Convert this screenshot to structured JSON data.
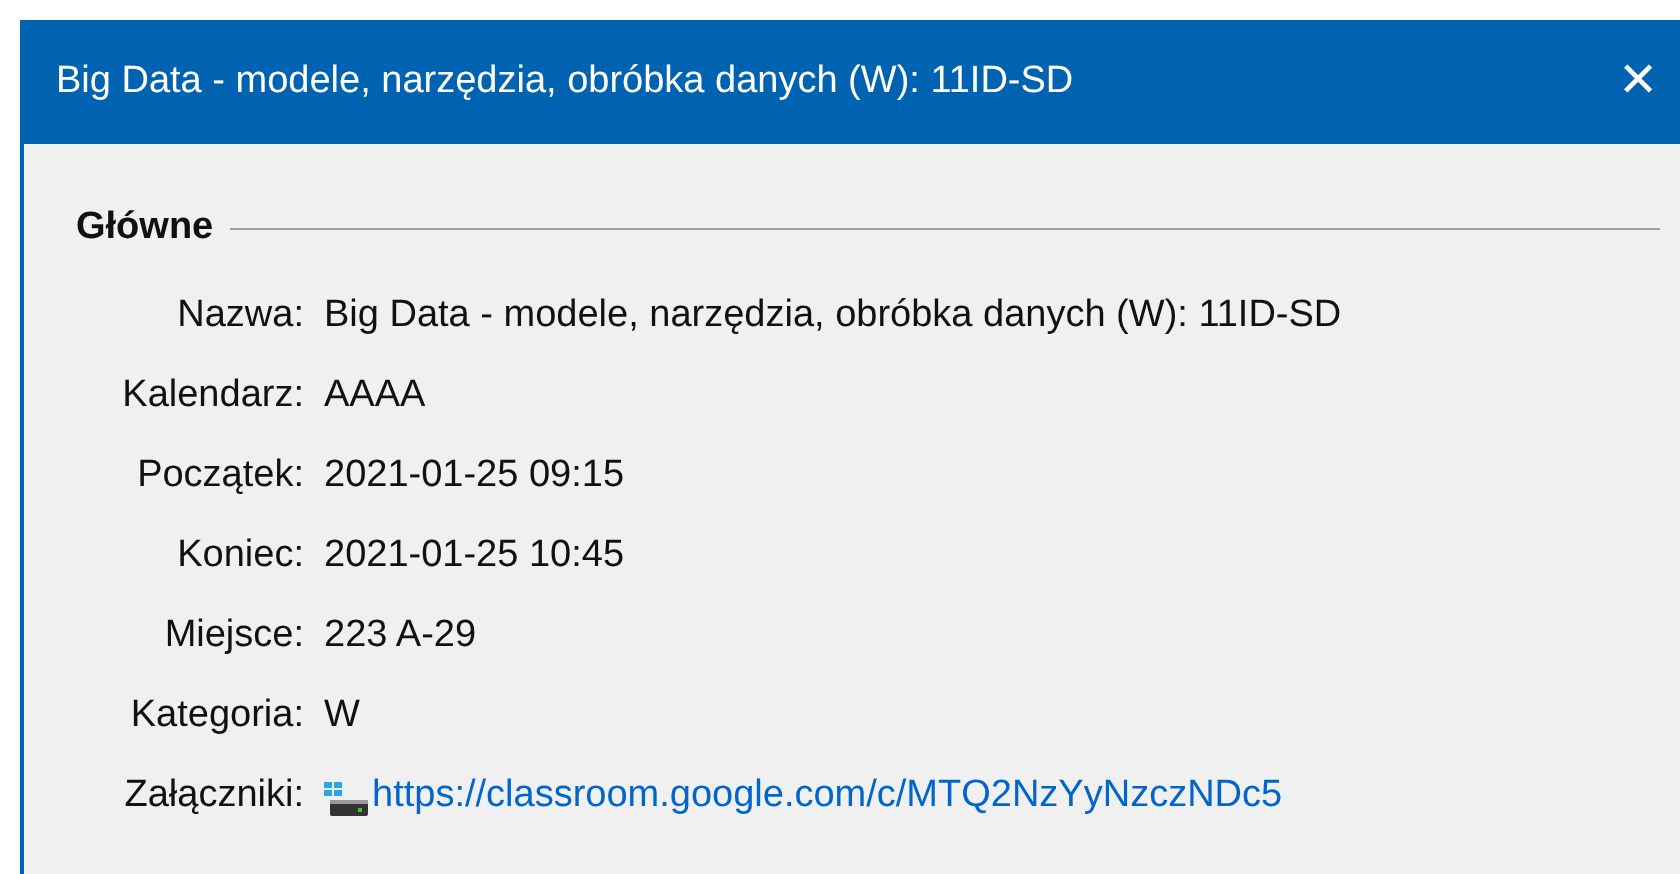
{
  "window": {
    "title": "Big Data - modele, narzędzia, obróbka danych (W): 11ID-SD",
    "close": "✕"
  },
  "section": {
    "title": "Główne"
  },
  "fields": [
    {
      "kind": "text",
      "label": "Nazwa:",
      "value": "Big Data - modele, narzędzia, obróbka danych (W): 11ID-SD"
    },
    {
      "kind": "text",
      "label": "Kalendarz:",
      "value": "AAAA"
    },
    {
      "kind": "text",
      "label": "Początek:",
      "value": "2021-01-25 09:15"
    },
    {
      "kind": "text",
      "label": "Koniec:",
      "value": "2021-01-25 10:45"
    },
    {
      "kind": "text",
      "label": "Miejsce:",
      "value": "223 A-29"
    },
    {
      "kind": "text",
      "label": "Kategoria:",
      "value": "W"
    },
    {
      "kind": "link",
      "label": "Załączniki:",
      "value": "https://classroom.google.com/c/MTQ2NzYyNzczNDc5"
    }
  ]
}
